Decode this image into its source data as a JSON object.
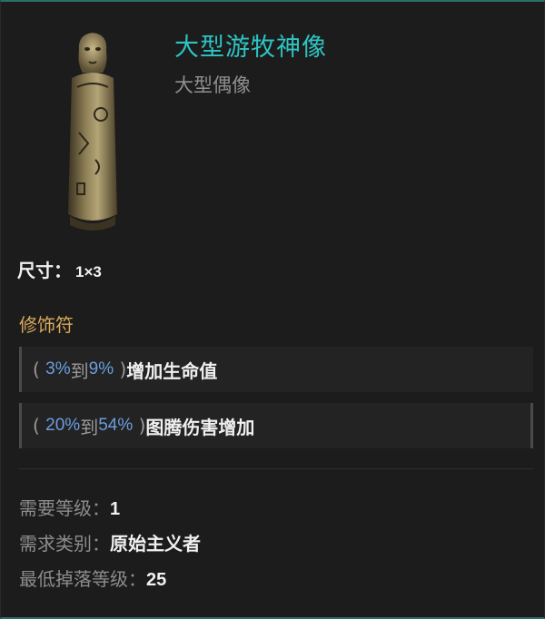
{
  "item": {
    "name": "大型游牧神像",
    "type": "大型偶像",
    "icon": "nomad-idol-statue-icon"
  },
  "size": {
    "label": "尺寸：",
    "value": "1×3"
  },
  "modifiers": {
    "title": "修饰符",
    "items": [
      {
        "open": "(",
        "min": "3%",
        "to": "到",
        "max": "9%",
        "close": ")",
        "stat": "增加生命值"
      },
      {
        "open": "(",
        "min": "20%",
        "to": "到",
        "max": "54%",
        "close": ")",
        "stat": "图腾伤害增加"
      }
    ]
  },
  "requirements": [
    {
      "label": "需要等级：",
      "value": "1"
    },
    {
      "label": "需求类别：",
      "value": "原始主义者"
    },
    {
      "label": "最低掉落等级：",
      "value": "25"
    }
  ],
  "colors": {
    "name": "#2ec4c4",
    "section_title": "#d9a95b",
    "range": "#6c9de0",
    "border_accent": "#2b6f66"
  }
}
